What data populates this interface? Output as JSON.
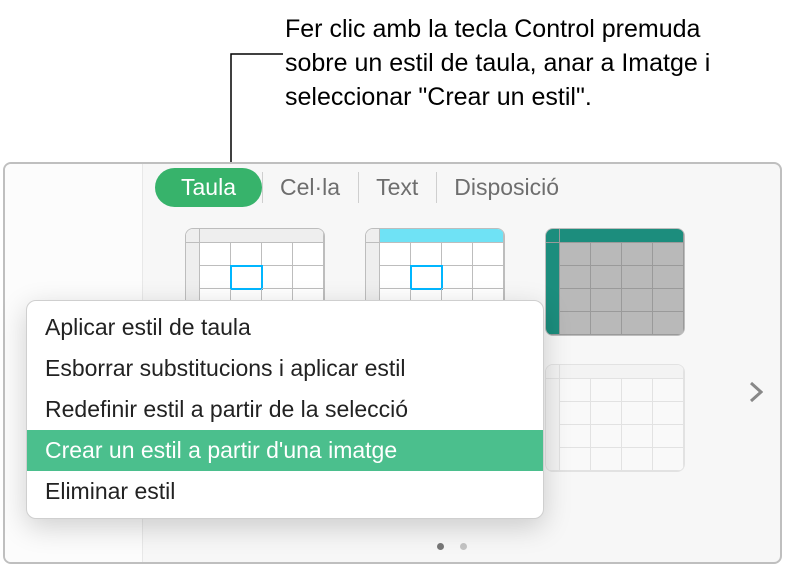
{
  "callout": {
    "text": "Fer clic amb la tecla Control premuda sobre un estil de taula, anar a Imatge i seleccionar \"Crear un estil\"."
  },
  "tabs": {
    "items": [
      {
        "label": "Taula",
        "active": true
      },
      {
        "label": "Cel·la",
        "active": false
      },
      {
        "label": "Text",
        "active": false
      },
      {
        "label": "Disposició",
        "active": false
      }
    ]
  },
  "context_menu": {
    "items": [
      {
        "label": "Aplicar estil de taula",
        "highlight": false
      },
      {
        "label": "Esborrar substitucions i aplicar estil",
        "highlight": false
      },
      {
        "label": "Redefinir estil a partir de la selecció",
        "highlight": false
      },
      {
        "label": "Crear un estil a partir d'una imatge",
        "highlight": true
      },
      {
        "label": "Eliminar estil",
        "highlight": false
      }
    ]
  },
  "pager": {
    "dots": 2,
    "active": 0
  }
}
